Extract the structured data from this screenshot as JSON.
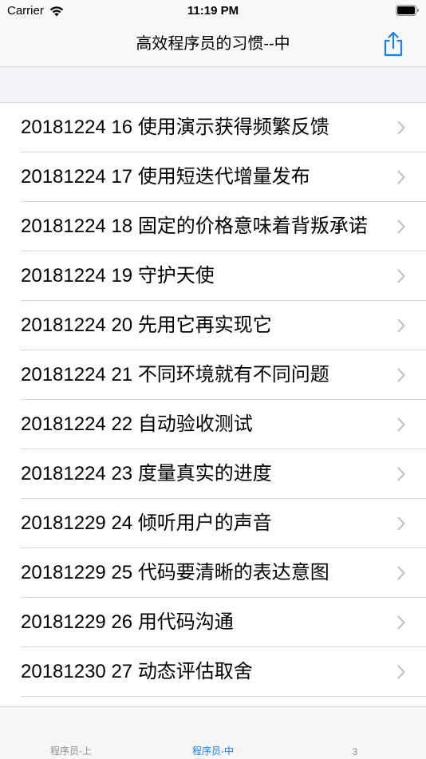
{
  "status_bar": {
    "carrier": "Carrier",
    "time": "11:19 PM"
  },
  "nav": {
    "title": "高效程序员的习惯--中",
    "share_icon": "share-icon"
  },
  "rows": [
    {
      "label": "20181224 16 使用演示获得频繁反馈"
    },
    {
      "label": "20181224 17 使用短迭代增量发布"
    },
    {
      "label": "20181224 18 固定的价格意味着背叛承诺"
    },
    {
      "label": "20181224 19 守护天使"
    },
    {
      "label": "20181224 20 先用它再实现它"
    },
    {
      "label": "20181224 21 不同环境就有不同问题"
    },
    {
      "label": "20181224 22 自动验收测试"
    },
    {
      "label": "20181224 23 度量真实的进度"
    },
    {
      "label": "20181229 24 倾听用户的声音"
    },
    {
      "label": "20181229 25 代码要清晰的表达意图"
    },
    {
      "label": "20181229 26 用代码沟通"
    },
    {
      "label": "20181230 27 动态评估取舍"
    }
  ],
  "tabs": [
    {
      "label": "程序员-上",
      "active": false
    },
    {
      "label": "程序员-中",
      "active": true
    },
    {
      "label": "3",
      "active": false
    }
  ],
  "colors": {
    "accent": "#147efb",
    "inactive_tab": "#8e8e93",
    "chevron": "#c4c4c7"
  }
}
